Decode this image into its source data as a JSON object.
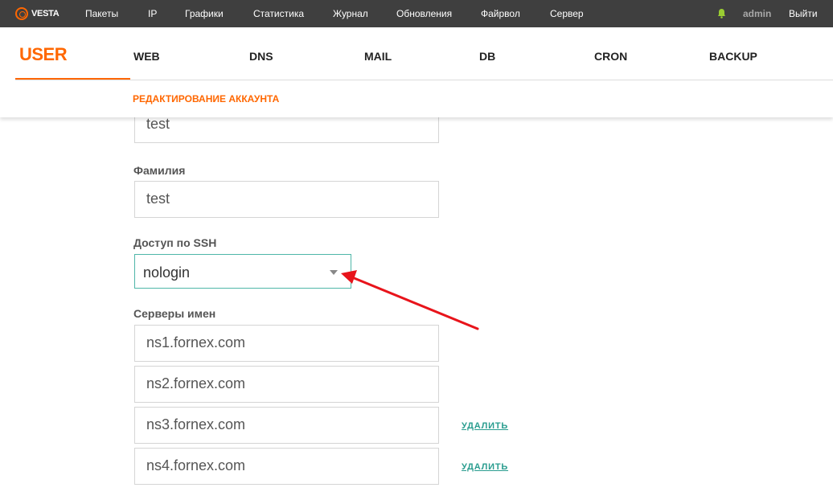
{
  "topbar": {
    "logo_text": "VESTA",
    "nav": [
      "Пакеты",
      "IP",
      "Графики",
      "Статистика",
      "Журнал",
      "Обновления",
      "Файрвол",
      "Сервер"
    ],
    "user": "admin",
    "logout": "Выйти"
  },
  "tabs": {
    "user": "USER",
    "web": "WEB",
    "dns": "DNS",
    "mail": "MAIL",
    "db": "DB",
    "cron": "CRON",
    "backup": "BACKUP"
  },
  "subtitle": "РЕДАКТИРОВАНИЕ АККАУНТА",
  "form": {
    "first_name_value": "test",
    "last_name_label": "Фамилия",
    "last_name_value": "test",
    "ssh_label": "Доступ по SSH",
    "ssh_value": "nologin",
    "ns_label": "Серверы имен",
    "nameservers": [
      "ns1.fornex.com",
      "ns2.fornex.com",
      "ns3.fornex.com",
      "ns4.fornex.com"
    ],
    "delete_label": "УДАЛИТЬ"
  },
  "colors": {
    "accent": "#ff6701",
    "topbar_bg": "#3f3f3f",
    "select_border": "#4fb6a8",
    "link": "#2a9d8f",
    "annotation_arrow": "#e8141b",
    "bell": "#9acd32"
  }
}
